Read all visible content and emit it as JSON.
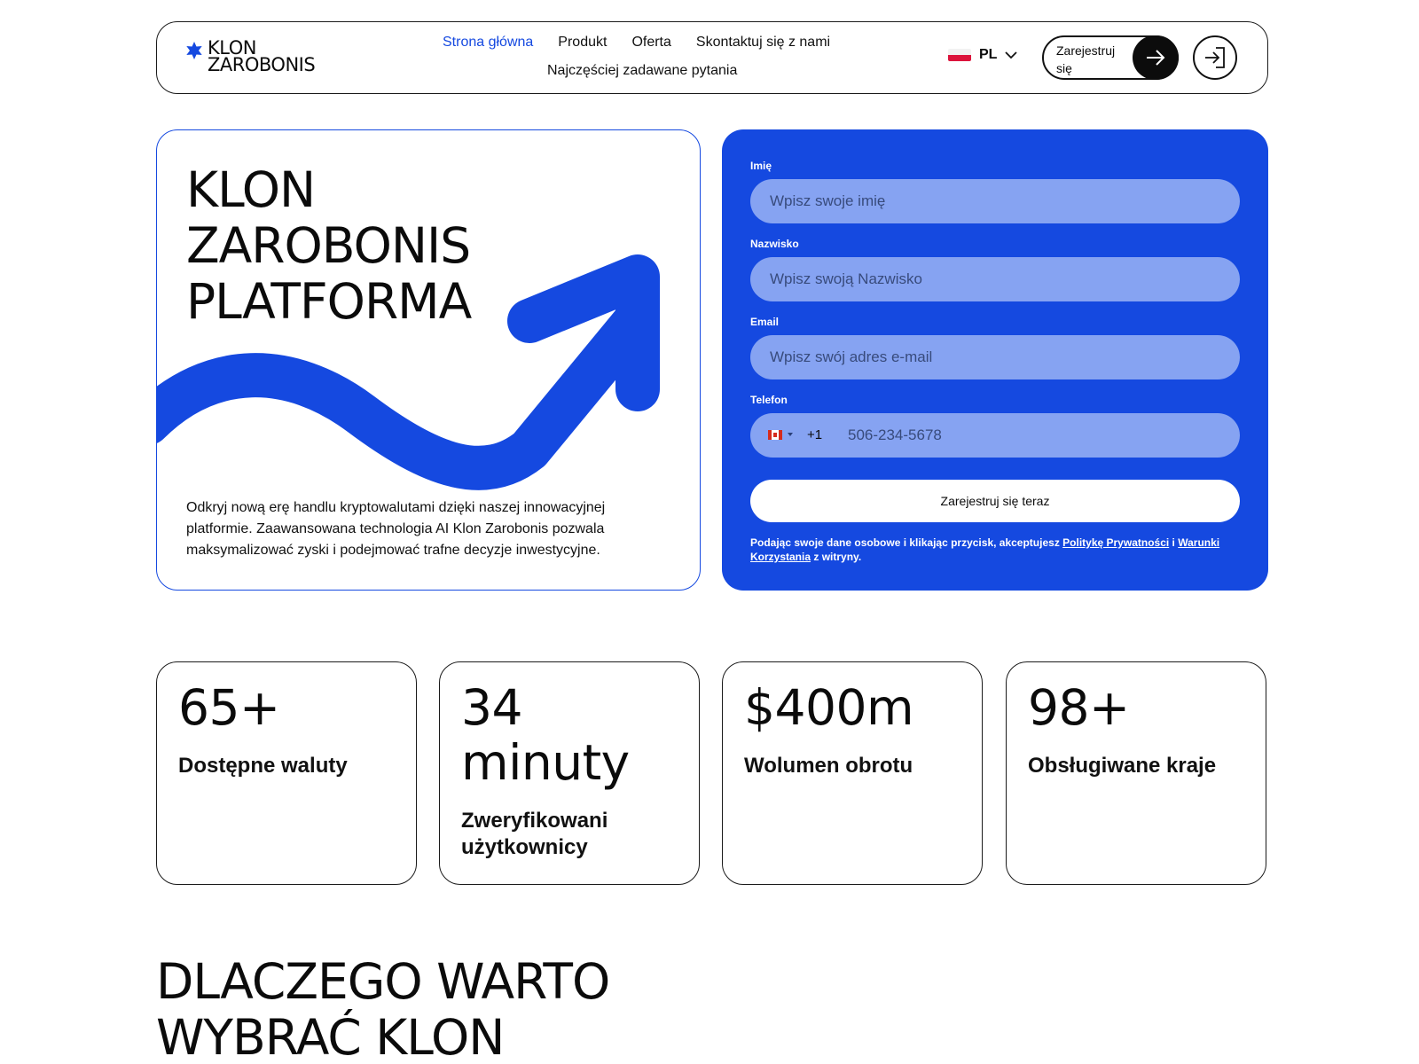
{
  "header": {
    "logo": {
      "line1": "KLON",
      "line2": "ZAROBONIS"
    },
    "nav": {
      "home": "Strona główna",
      "product": "Produkt",
      "offer": "Oferta",
      "contact": "Skontaktuj się z nami",
      "faq": "Najczęściej zadawane pytania"
    },
    "language": "PL",
    "register_label": "Zarejestruj się"
  },
  "hero": {
    "title_lines": [
      "KLON",
      "ZAROBONIS",
      "PLATFORMA"
    ],
    "description": "Odkryj nową erę handlu kryptowalutami dzięki naszej innowacyjnej platformie. Zaawansowana technologia AI Klon Zarobonis pozwala maksymalizować zyski i podejmować trafne decyzje inwestycyjne."
  },
  "form": {
    "first_name": {
      "label": "Imię",
      "placeholder": "Wpisz swoje imię"
    },
    "last_name": {
      "label": "Nazwisko",
      "placeholder": "Wpisz swoją Nazwisko"
    },
    "email": {
      "label": "Email",
      "placeholder": "Wpisz swój adres e-mail"
    },
    "phone": {
      "label": "Telefon",
      "country_code": "+1",
      "placeholder": "506-234-5678"
    },
    "submit_label": "Zarejestruj się teraz",
    "consent": {
      "prefix": "Podając swoje dane osobowe i klikając przycisk, akceptujesz ",
      "privacy_link": "Politykę Prywatności",
      "and": " i ",
      "terms_link": "Warunki Korzystania",
      "suffix": " z witryny."
    }
  },
  "stats": [
    {
      "value": "65+",
      "label": "Dostępne waluty"
    },
    {
      "value": "34 minuty",
      "label": "Zweryfikowani użytkownicy"
    },
    {
      "value": "$400m",
      "label": "Wolumen obrotu"
    },
    {
      "value": "98+",
      "label": "Obsługiwane kraje"
    }
  ],
  "why": {
    "title_lines": [
      "DLACZEGO WARTO",
      "WYBRAĆ KLON"
    ]
  },
  "colors": {
    "accent": "#1549e0",
    "input_fill": "#86a3f2",
    "dark": "#0c0c0c"
  }
}
